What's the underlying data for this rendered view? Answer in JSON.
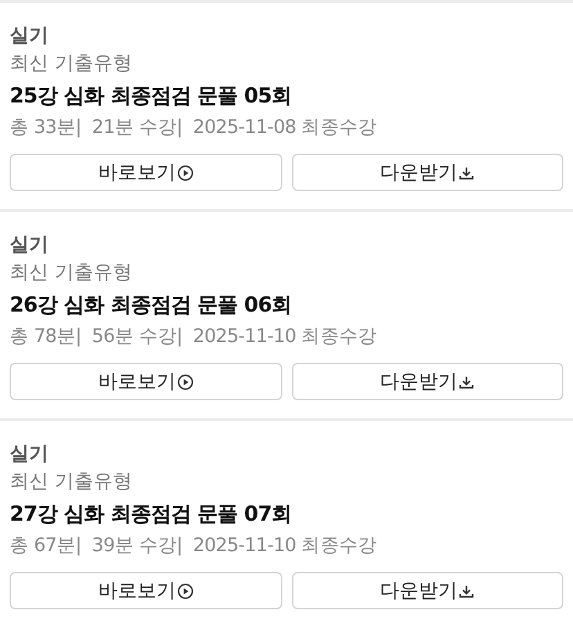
{
  "lectures": [
    {
      "category": "실기",
      "subtitle": "최신 기출유형",
      "title": "25강 심화 최종점검 문풀 05회",
      "meta": "총 33분|  21분 수강|  2025-11-08 최종수강",
      "buttons": [
        {
          "label": "바로보기",
          "kind": "view"
        },
        {
          "label": "다운받기",
          "kind": "download"
        }
      ]
    },
    {
      "category": "실기",
      "subtitle": "최신 기출유형",
      "title": "26강 심화 최종점검 문풀 06회",
      "meta": "총 78분|  56분 수강|  2025-11-10 최종수강",
      "buttons": [
        {
          "label": "바로보기",
          "kind": "view"
        },
        {
          "label": "다운받기",
          "kind": "download"
        }
      ]
    },
    {
      "category": "실기",
      "subtitle": "최신 기출유형",
      "title": "27강 심화 최종점검 문풀 07회",
      "meta": "총 67분|  39분 수강|  2025-11-10 최종수강",
      "buttons": [
        {
          "label": "바로보기",
          "kind": "view"
        },
        {
          "label": "다운받기",
          "kind": "download"
        }
      ]
    }
  ]
}
